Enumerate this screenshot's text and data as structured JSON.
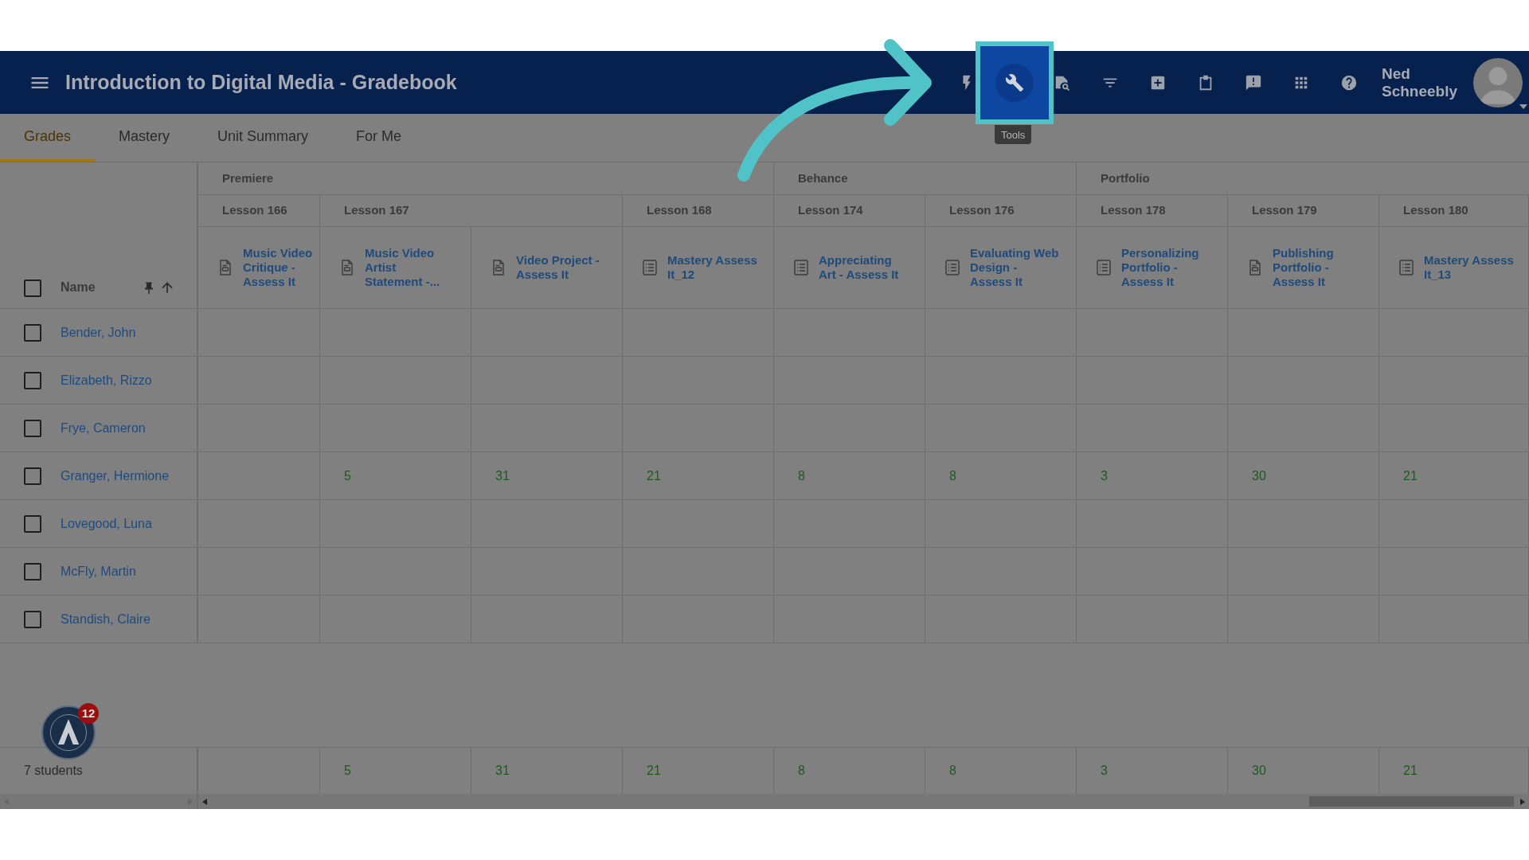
{
  "header": {
    "title": "Introduction to Digital Media - Gradebook",
    "toolbar": [
      {
        "kind": "bolt",
        "highlighted": false
      },
      {
        "kind": "wrench",
        "highlighted": true
      },
      {
        "kind": "search",
        "highlighted": false
      },
      {
        "kind": "filter",
        "highlighted": false
      },
      {
        "kind": "add",
        "highlighted": false
      },
      {
        "kind": "clipboard",
        "highlighted": false
      },
      {
        "kind": "feedback",
        "highlighted": false
      },
      {
        "kind": "apps",
        "highlighted": false
      },
      {
        "kind": "help",
        "highlighted": false
      }
    ],
    "tooltip": "Tools",
    "user": {
      "first": "Ned",
      "last": "Schneebly"
    }
  },
  "tabs": [
    {
      "label": "Grades",
      "selected": true
    },
    {
      "label": "Mastery",
      "selected": false
    },
    {
      "label": "Unit Summary",
      "selected": false
    },
    {
      "label": "For Me",
      "selected": false
    }
  ],
  "table": {
    "name_header": "Name",
    "groups": [
      {
        "label": "Premiere",
        "lessons": [
          {
            "label": "Lesson 166",
            "columns": [
              {
                "title": "Music Video Critique - Assess It",
                "kind": "document"
              }
            ]
          },
          {
            "label": "Lesson 167",
            "columns": [
              {
                "title": "Music Video Artist Statement -...",
                "kind": "document"
              },
              {
                "title": "Video Project - Assess It",
                "kind": "document"
              }
            ]
          },
          {
            "label": "Lesson 168",
            "columns": [
              {
                "title": "Mastery Assess It_12",
                "kind": "checklist"
              }
            ]
          }
        ]
      },
      {
        "label": "Behance",
        "lessons": [
          {
            "label": "Lesson 174",
            "columns": [
              {
                "title": "Appreciating Art - Assess It",
                "kind": "checklist"
              }
            ]
          },
          {
            "label": "Lesson 176",
            "columns": [
              {
                "title": "Evaluating Web Design - Assess It",
                "kind": "checklist"
              }
            ]
          }
        ]
      },
      {
        "label": "Portfolio",
        "lessons": [
          {
            "label": "Lesson 178",
            "columns": [
              {
                "title": "Personalizing Portfolio - Assess It",
                "kind": "checklist"
              }
            ]
          },
          {
            "label": "Lesson 179",
            "columns": [
              {
                "title": "Publishing Portfolio - Assess It",
                "kind": "document"
              }
            ]
          },
          {
            "label": "Lesson 180",
            "columns": [
              {
                "title": "Mastery Assess It_13",
                "kind": "checklist"
              }
            ]
          }
        ]
      }
    ],
    "rows": [
      {
        "name": "Bender, John",
        "checked": false
      },
      {
        "name": "Elizabeth, Rizzo",
        "checked": false
      },
      {
        "name": "Frye, Cameron",
        "checked": false
      },
      {
        "name": "Granger, Hermione",
        "checked": false,
        "scores": [
          "5",
          "31",
          "21",
          "8",
          "8",
          "3",
          "30",
          "21"
        ]
      },
      {
        "name": "Lovegood, Luna",
        "checked": false
      },
      {
        "name": "McFly, Martin",
        "checked": false
      },
      {
        "name": "Standish, Claire",
        "checked": false
      }
    ],
    "select_all_checked": false,
    "footer": {
      "label": "7 students",
      "totals": [
        "5",
        "31",
        "21",
        "8",
        "8",
        "3",
        "30",
        "21"
      ]
    }
  },
  "notification_count": "12"
}
